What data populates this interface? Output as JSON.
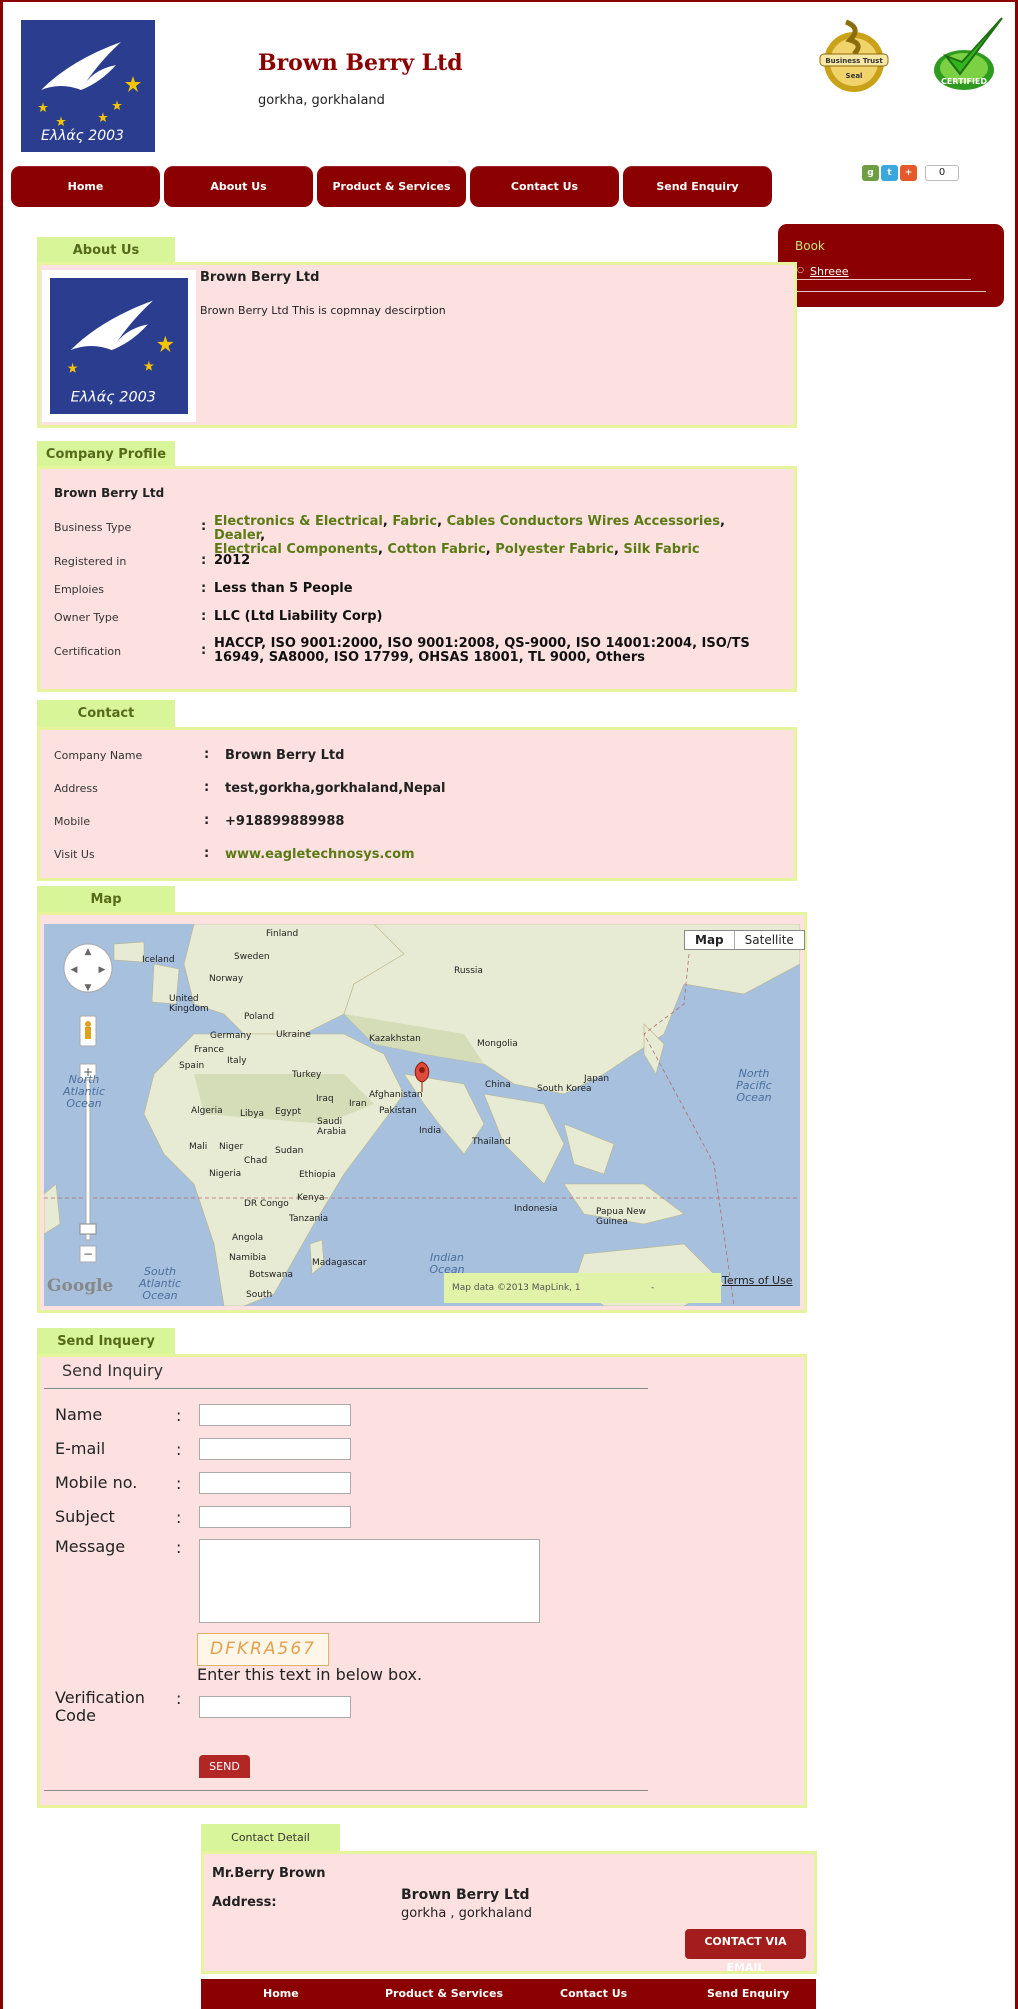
{
  "header": {
    "company_name": "Brown Berry Ltd",
    "location": "gorkha, gorkhaland",
    "logo_text": "Ελλάς 2003",
    "seal_text_top": "Business Trust",
    "seal_text_bottom": "Seal",
    "certified_text": "CERTIFIED"
  },
  "nav": [
    "Home",
    "About Us",
    "Product & Services",
    "Contact Us",
    "Send Enquiry"
  ],
  "share": {
    "count": "0"
  },
  "sidebar": {
    "title": "Book",
    "items": [
      "Shreee"
    ]
  },
  "about": {
    "tab": "About Us",
    "name": "Brown Berry Ltd",
    "description": "Brown Berry Ltd This is copmnay descirption"
  },
  "profile": {
    "tab": "Company Profile",
    "name": "Brown Berry Ltd",
    "business_type_label": "Business Type",
    "business_types": [
      "Electronics & Electrical",
      "Fabric",
      "Cables Conductors Wires Accessories",
      "Dealer",
      "Electrical Components",
      "Cotton Fabric",
      "Polyester Fabric",
      "Silk Fabric"
    ],
    "registered_label": "Registered in",
    "registered": "2012",
    "employees_label": "Emploies",
    "employees": "Less than 5 People",
    "owner_label": "Owner Type",
    "owner": "LLC (Ltd Liability Corp)",
    "cert_label": "Certification",
    "certification": "HACCP, ISO 9001:2000, ISO 9001:2008, QS-9000, ISO 14001:2004, ISO/TS 16949, SA8000, ISO 17799, OHSAS 18001, TL 9000, Others",
    "colon": ":"
  },
  "contact": {
    "tab": "Contact",
    "company_label": "Company Name",
    "company": "Brown Berry Ltd",
    "address_label": "Address",
    "address": "test,gorkha,gorkhaland,Nepal",
    "mobile_label": "Mobile",
    "mobile": "+918899889988",
    "visit_label": "Visit Us",
    "website": "www.eagletechnosys.com"
  },
  "map": {
    "tab": "Map",
    "type_map": "Map",
    "type_satellite": "Satellite",
    "attribution": "Map data ©2013 MapLink, 1",
    "attribution_dash": "-",
    "terms": "Terms of Use",
    "google": "Google",
    "labels": {
      "finland": "Finland",
      "iceland": "Iceland",
      "sweden": "Sweden",
      "norway": "Norway",
      "russia": "Russia",
      "uk": "United Kingdom",
      "poland": "Poland",
      "germany": "Germany",
      "ukraine": "Ukraine",
      "france": "France",
      "italy": "Italy",
      "spain": "Spain",
      "kazakhstan": "Kazakhstan",
      "mongolia": "Mongolia",
      "turkey": "Turkey",
      "china": "China",
      "afghanistan": "Afghanistan",
      "south_korea": "South Korea",
      "japan": "Japan",
      "iraq": "Iraq",
      "iran": "Iran",
      "pakistan": "Pakistan",
      "algeria": "Algeria",
      "libya": "Libya",
      "egypt": "Egypt",
      "saudi": "Saudi Arabia",
      "india": "India",
      "thailand": "Thailand",
      "mali": "Mali",
      "niger": "Niger",
      "chad": "Chad",
      "sudan": "Sudan",
      "nigeria": "Nigeria",
      "ethiopia": "Ethiopia",
      "kenya": "Kenya",
      "drc": "DR Congo",
      "indonesia": "Indonesia",
      "png": "Papua New Guinea",
      "tanzania": "Tanzania",
      "angola": "Angola",
      "namibia": "Namibia",
      "madagascar": "Madagascar",
      "botswana": "Botswana",
      "south": "South"
    },
    "oceans": {
      "north_atlantic": "North Atlantic Ocean",
      "north_pacific": "North Pacific Ocean",
      "indian": "Indian Ocean",
      "south_atlantic": "South Atlantic Ocean"
    }
  },
  "inquiry": {
    "tab": "Send Inquery",
    "title": "Send Inquiry",
    "name_label": "Name",
    "email_label": "E-mail",
    "mobile_label": "Mobile no.",
    "subject_label": "Subject",
    "message_label": "Message",
    "captcha": "DFKRA567",
    "captcha_help": "Enter this text in below box.",
    "verification_label": "Verification Code",
    "send": "SEND",
    "colon": ":"
  },
  "contact_detail": {
    "tab": "Contact Detail",
    "person": "Mr.Berry Brown",
    "address_label": "Address:",
    "company": "Brown Berry Ltd",
    "location": "gorkha , gorkhaland",
    "button": "CONTACT VIA EMAIL"
  },
  "footer_nav": [
    "Home",
    "Product & Services",
    "Contact Us",
    "Send Enquiry"
  ]
}
